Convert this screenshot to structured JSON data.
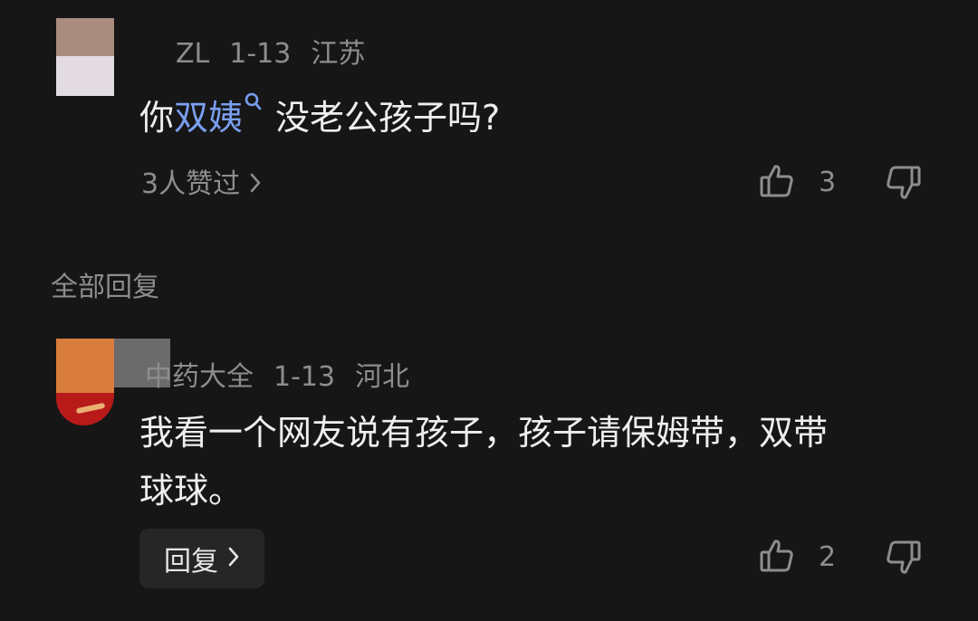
{
  "comment": {
    "author": "ZL",
    "date": "1-13",
    "location": "江苏",
    "text_before": "你",
    "text_link": "双姨",
    "text_after": "没老公孩子吗?",
    "liked_by": "3人赞过",
    "like_count": "3"
  },
  "replies_header": "全部回复",
  "reply": {
    "author": "中药大全",
    "date": "1-13",
    "location": "河北",
    "text_line1": "我看一个网友说有孩子，孩子请保姆带，双带",
    "text_line2": "球球。",
    "reply_label": "回复",
    "like_count": "2"
  },
  "icons": {
    "like": "thumbs-up-icon",
    "dislike": "thumbs-down-icon",
    "chevron": "chevron-right-icon",
    "search": "search-icon"
  },
  "colors": {
    "background": "#161616",
    "link": "#7a9ff0",
    "muted": "#8d8d8d"
  }
}
